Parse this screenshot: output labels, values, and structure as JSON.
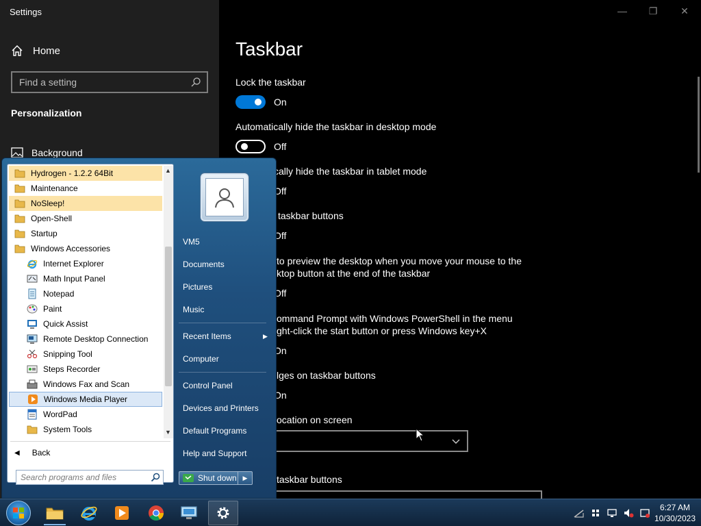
{
  "settings": {
    "window_title": "Settings",
    "home_label": "Home",
    "search_placeholder": "Find a setting",
    "section_title": "Personalization",
    "nav_background": "Background",
    "page_title": "Taskbar",
    "rows": [
      {
        "label": "Lock the taskbar",
        "state": "On"
      },
      {
        "label": "Automatically hide the taskbar in desktop mode",
        "state": "Off"
      },
      {
        "label": "cally hide the taskbar in tablet mode",
        "state": "Off"
      },
      {
        "label": "taskbar buttons",
        "state": "Off"
      },
      {
        "label": "to preview the desktop when you move your mouse to the",
        "label2": "ktop button at the end of the taskbar",
        "state": "Off"
      },
      {
        "label": "ommand Prompt with Windows PowerShell in the menu",
        "label2": "ght-click the start button or press Windows key+X",
        "state": "On"
      },
      {
        "label": "lges on taskbar buttons",
        "state": "On"
      },
      {
        "label": "ocation on screen"
      },
      {
        "label": "taskbar buttons"
      }
    ]
  },
  "start_menu": {
    "programs": [
      {
        "label": "Hydrogen - 1.2.2 64Bit",
        "type": "folder",
        "hl": true
      },
      {
        "label": "Maintenance",
        "type": "folder"
      },
      {
        "label": "NoSleep!",
        "type": "folder",
        "hl": true
      },
      {
        "label": "Open-Shell",
        "type": "folder"
      },
      {
        "label": "Startup",
        "type": "folder"
      },
      {
        "label": "Windows Accessories",
        "type": "folder"
      },
      {
        "label": "Internet Explorer",
        "type": "ie",
        "sub": true
      },
      {
        "label": "Math Input Panel",
        "type": "math",
        "sub": true
      },
      {
        "label": "Notepad",
        "type": "notepad",
        "sub": true
      },
      {
        "label": "Paint",
        "type": "paint",
        "sub": true
      },
      {
        "label": "Quick Assist",
        "type": "assist",
        "sub": true
      },
      {
        "label": "Remote Desktop Connection",
        "type": "rdp",
        "sub": true
      },
      {
        "label": "Snipping Tool",
        "type": "snip",
        "sub": true
      },
      {
        "label": "Steps Recorder",
        "type": "steps",
        "sub": true
      },
      {
        "label": "Windows Fax and Scan",
        "type": "fax",
        "sub": true
      },
      {
        "label": "Windows Media Player",
        "type": "wmp",
        "sub": true,
        "sel": true
      },
      {
        "label": "WordPad",
        "type": "wordpad",
        "sub": true
      },
      {
        "label": "System Tools",
        "type": "folder",
        "sub": true
      }
    ],
    "back_label": "Back",
    "search_placeholder": "Search programs and files",
    "right_items": {
      "user": "VM5",
      "documents": "Documents",
      "pictures": "Pictures",
      "music": "Music",
      "recent_items": "Recent Items",
      "computer": "Computer",
      "control_panel": "Control Panel",
      "devices_printers": "Devices and Printers",
      "default_programs": "Default Programs",
      "help_support": "Help and Support"
    },
    "shutdown_label": "Shut down"
  },
  "taskbar": {
    "time": "6:27 AM",
    "date": "10/30/2023"
  },
  "colors": {
    "accent": "#0078d7",
    "folder": "#e8b84a"
  }
}
